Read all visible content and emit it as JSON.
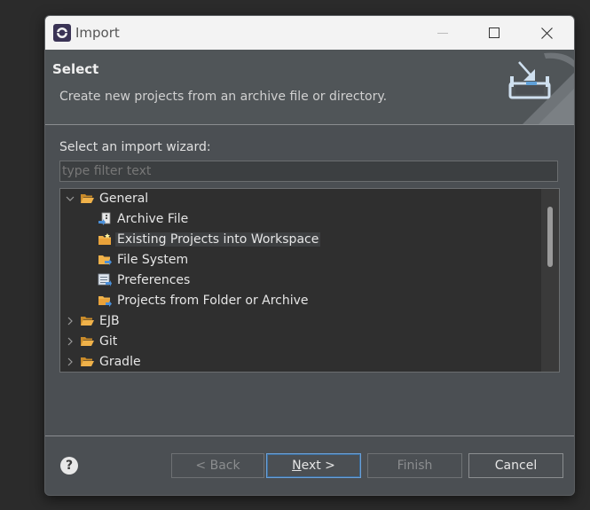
{
  "window": {
    "title": "Import"
  },
  "header": {
    "title": "Select",
    "description": "Create new projects from an archive file or directory."
  },
  "wizard": {
    "label": "Select an import wizard:",
    "filter_placeholder": "type filter text"
  },
  "tree": {
    "items": [
      {
        "label": "General",
        "level": 0,
        "expanded": true,
        "icon": "folder-open-icon"
      },
      {
        "label": "Archive File",
        "level": 1,
        "icon": "archive-file-icon"
      },
      {
        "label": "Existing Projects into Workspace",
        "level": 1,
        "icon": "existing-projects-icon",
        "selected": true
      },
      {
        "label": "File System",
        "level": 1,
        "icon": "file-system-icon"
      },
      {
        "label": "Preferences",
        "level": 1,
        "icon": "preferences-icon"
      },
      {
        "label": "Projects from Folder or Archive",
        "level": 1,
        "icon": "projects-folder-icon"
      },
      {
        "label": "EJB",
        "level": 0,
        "expanded": false,
        "icon": "folder-icon"
      },
      {
        "label": "Git",
        "level": 0,
        "expanded": false,
        "icon": "folder-icon"
      },
      {
        "label": "Gradle",
        "level": 0,
        "expanded": false,
        "icon": "folder-icon"
      }
    ]
  },
  "buttons": {
    "back": "< Back",
    "next_mnemonic": "N",
    "next_rest": "ext >",
    "finish": "Finish",
    "cancel": "Cancel",
    "help": "?"
  },
  "colors": {
    "background": "#2b2b2b",
    "dialog": "#4b4f53",
    "titlebar": "#f3f3f3",
    "folder": "#e8a33a",
    "default_button_border": "#6aa0d8"
  }
}
